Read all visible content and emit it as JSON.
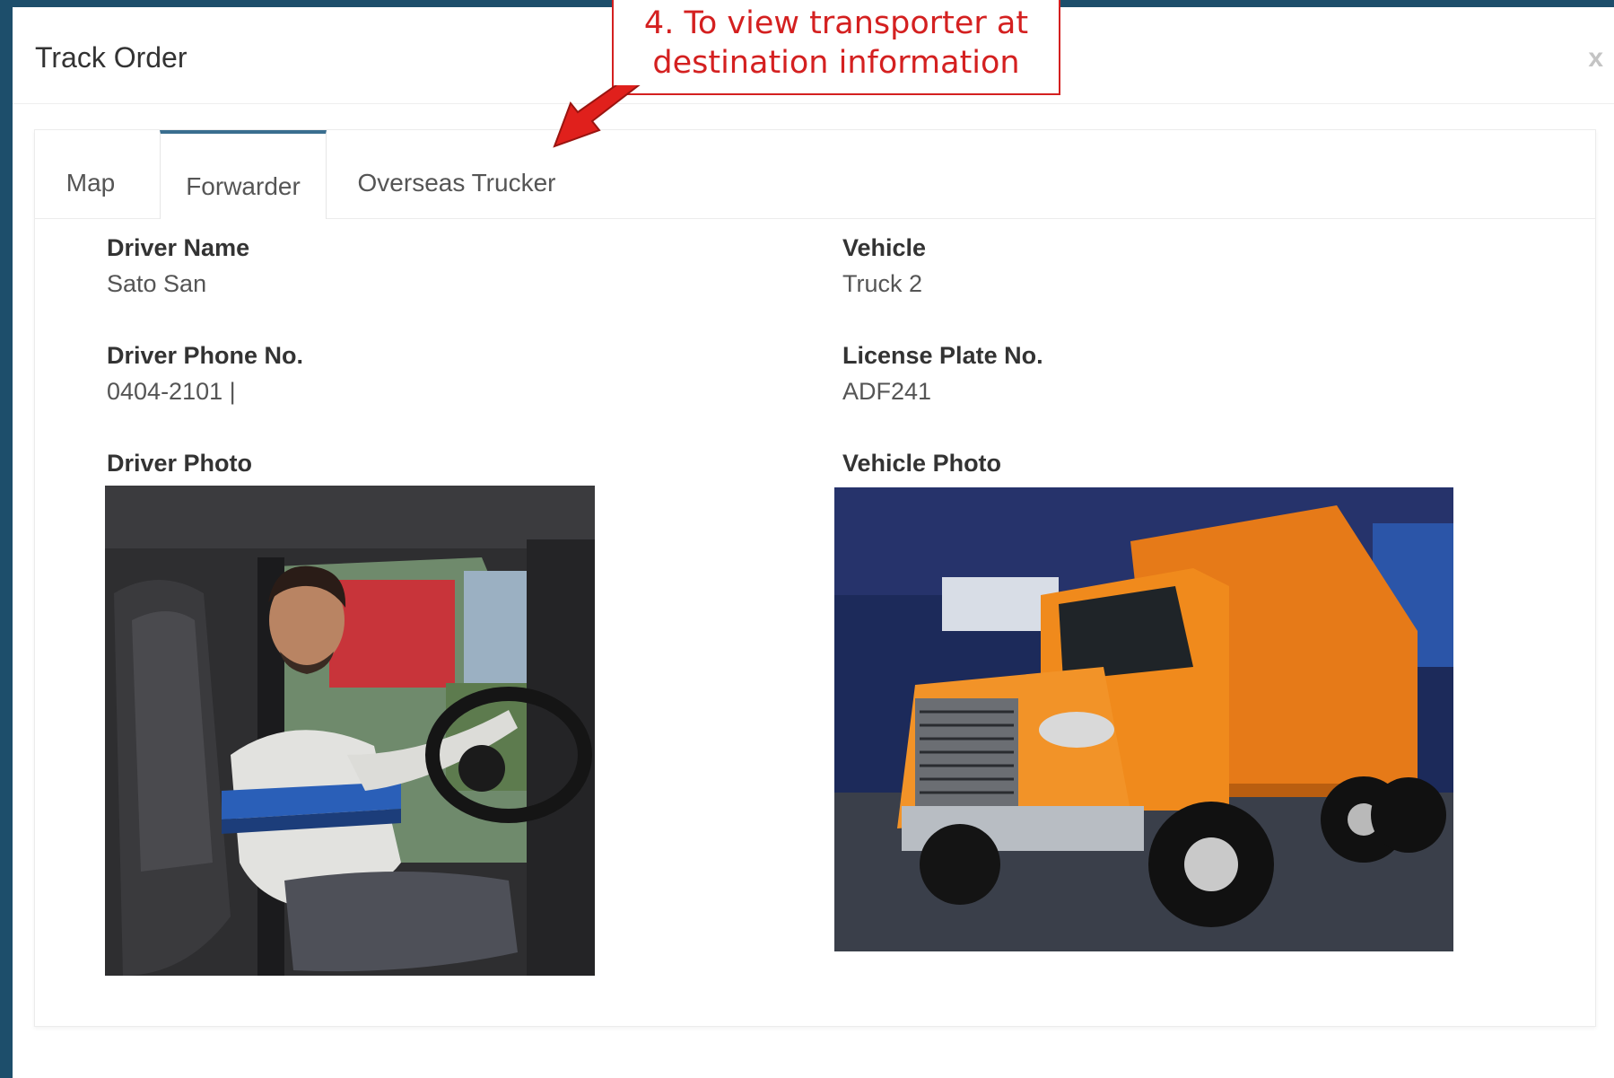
{
  "modal": {
    "title": "Track Order",
    "close_label": "x"
  },
  "tabs": [
    {
      "label": "Map",
      "active": false
    },
    {
      "label": "Forwarder",
      "active": true
    },
    {
      "label": "Overseas Trucker",
      "active": false
    }
  ],
  "details": {
    "driver_name_label": "Driver Name",
    "driver_name": "Sato San",
    "vehicle_label": "Vehicle",
    "vehicle": "Truck 2",
    "driver_phone_label": "Driver Phone No.",
    "driver_phone": "0404-2101 |",
    "license_plate_label": "License Plate No.",
    "license_plate": "ADF241",
    "driver_photo_label": "Driver Photo",
    "vehicle_photo_label": "Vehicle Photo"
  },
  "annotation": {
    "line1": "4. To view transporter at",
    "line2": "destination information"
  },
  "colors": {
    "backdrop": "#1d4e6b",
    "active_tab_border": "#3a6e8f",
    "annotation_red": "#d42020",
    "truck_orange": "#f08a1c"
  }
}
